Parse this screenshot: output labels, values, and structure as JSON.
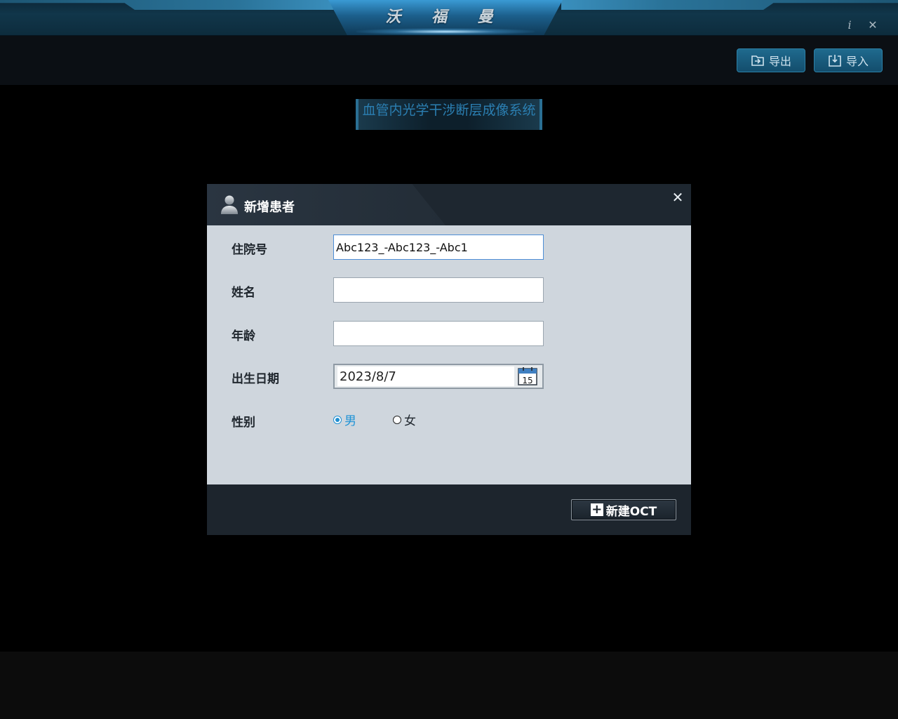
{
  "app": {
    "brand": "沃 福 曼",
    "info_glyph": "i",
    "close_glyph": "✕"
  },
  "toolbar": {
    "export_label": "导出",
    "import_label": "导入"
  },
  "banner": {
    "system_name": "血管内光学干涉断层成像系统"
  },
  "dialog": {
    "title": "新增患者",
    "close_glyph": "✕",
    "fields": {
      "admission_no": {
        "label": "住院号",
        "value": "Abc123_-Abc123_-Abc1"
      },
      "name": {
        "label": "姓名",
        "value": ""
      },
      "age": {
        "label": "年龄",
        "value": ""
      },
      "birth_date": {
        "label": "出生日期",
        "value": "2023/8/7",
        "calendar_day": "15"
      },
      "gender": {
        "label": "性别",
        "options": [
          "男",
          "女"
        ],
        "selected": "男"
      }
    },
    "footer": {
      "new_oct_label": "新建OCT"
    }
  },
  "colors": {
    "accent": "#1d92d6",
    "dialog_bg": "#cfd6dd",
    "header_bg": "#1e2730",
    "toolbar_button": "#1f6a8e"
  }
}
